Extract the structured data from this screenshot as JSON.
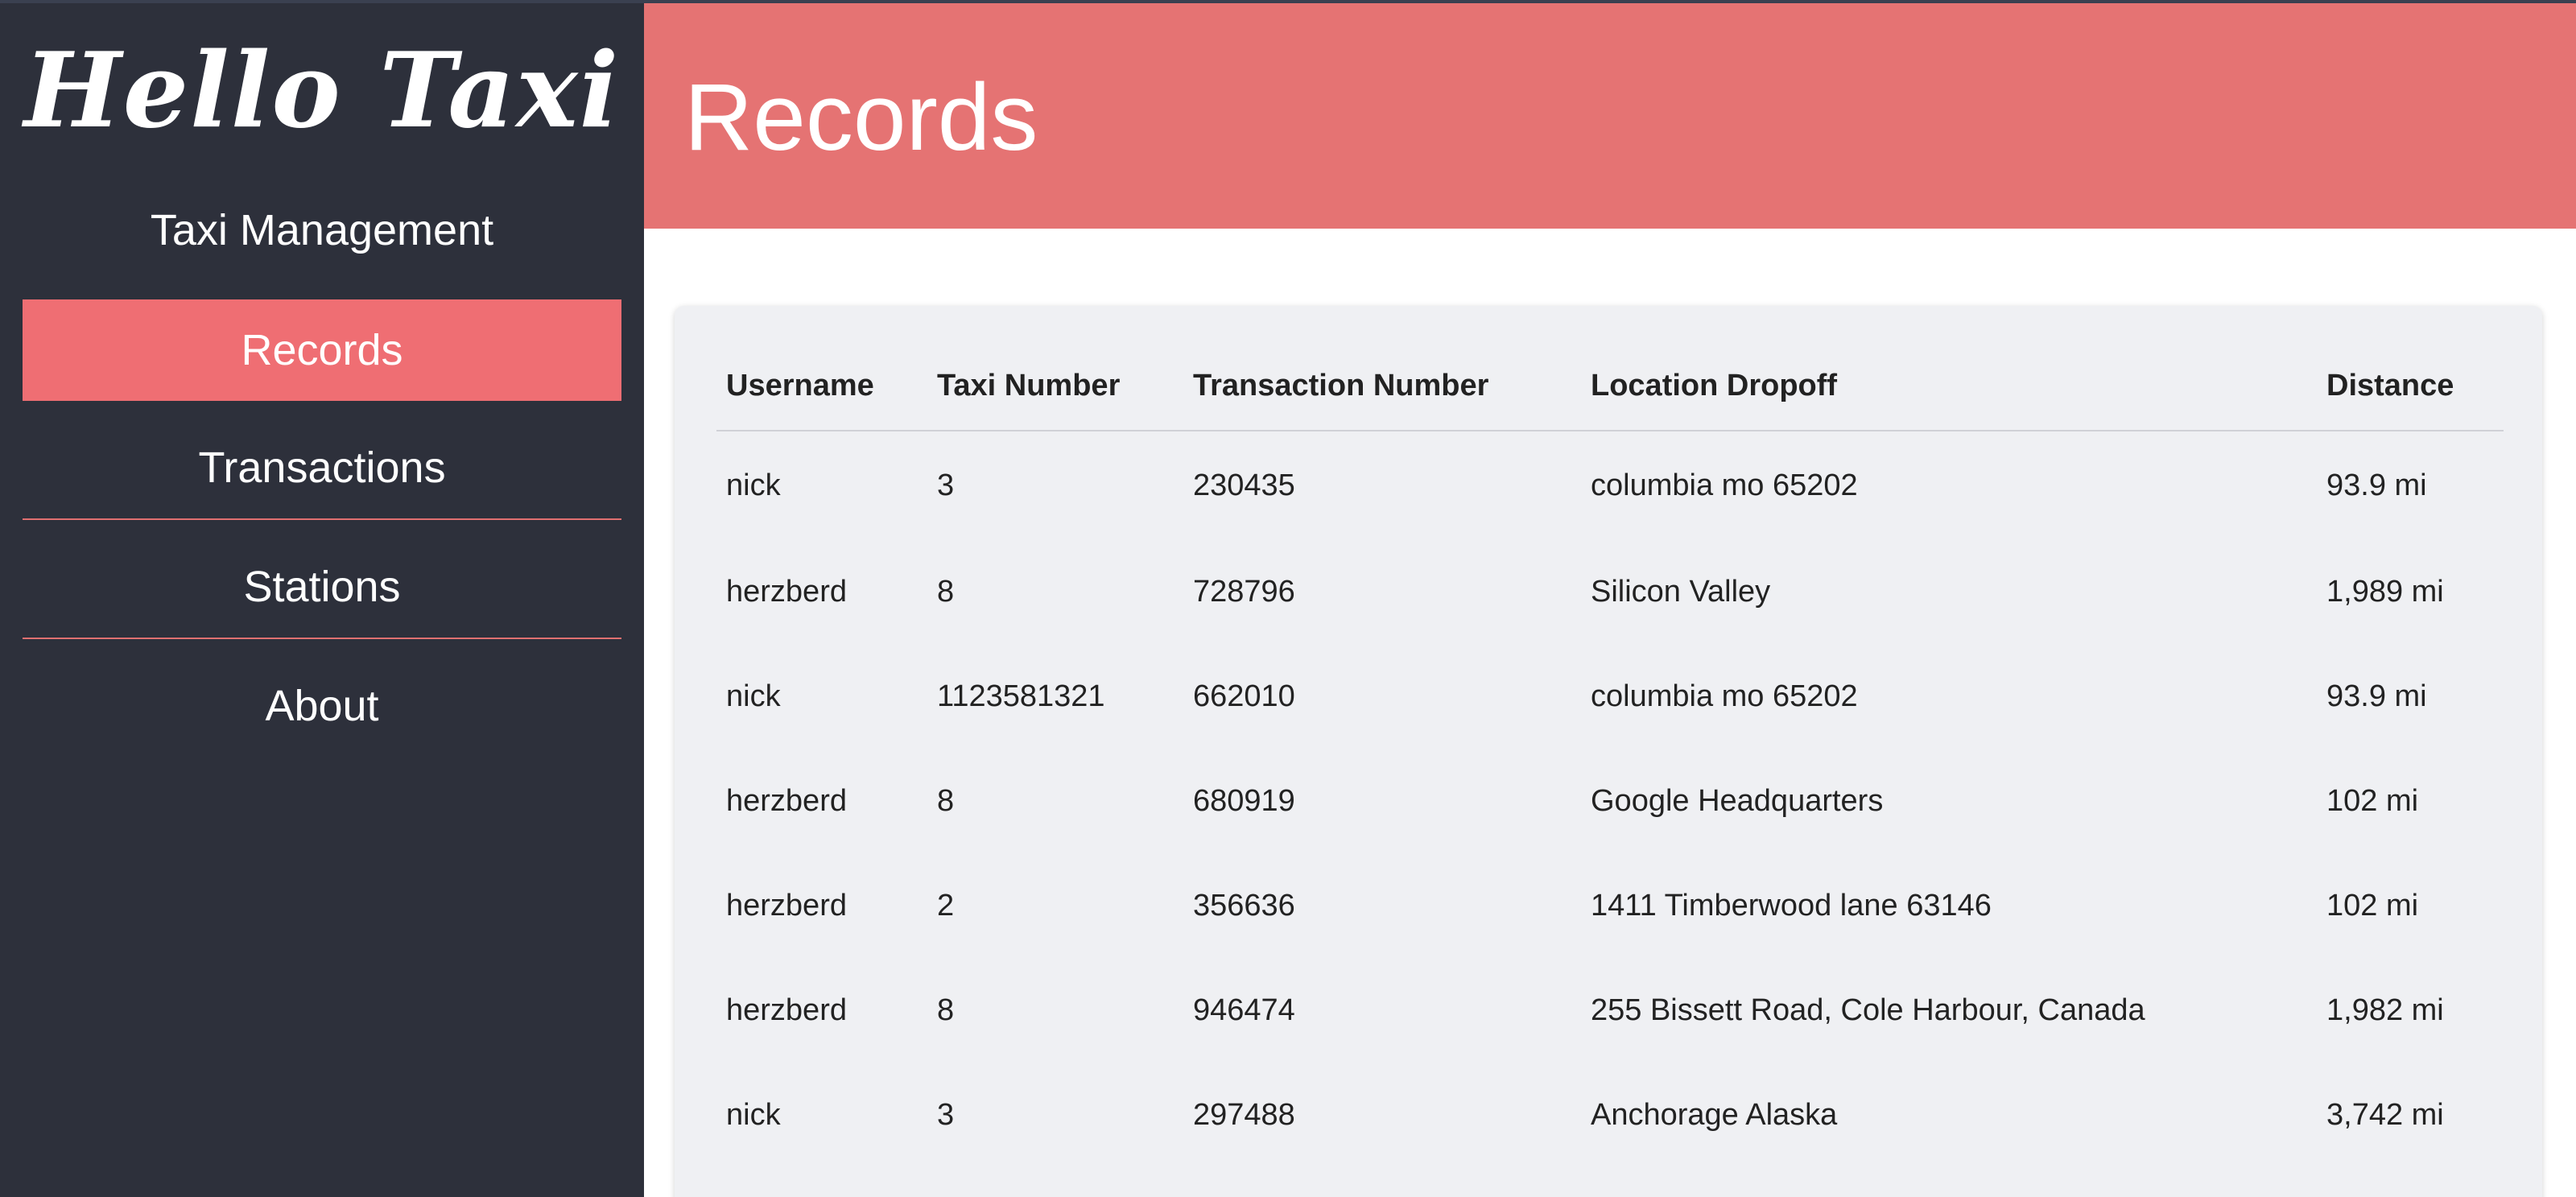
{
  "sidebar": {
    "brand": "Hello Taxi",
    "subtitle": "Taxi Management",
    "nav": [
      {
        "label": "Records",
        "active": true
      },
      {
        "label": "Transactions",
        "active": false
      },
      {
        "label": "Stations",
        "active": false
      },
      {
        "label": "About",
        "active": false
      }
    ]
  },
  "header": {
    "title": "Records"
  },
  "table": {
    "columns": [
      "Username",
      "Taxi Number",
      "Transaction Number",
      "Location Dropoff",
      "Distance"
    ],
    "rows": [
      [
        "nick",
        "3",
        "230435",
        "columbia mo 65202",
        "93.9 mi"
      ],
      [
        "herzberd",
        "8",
        "728796",
        "Silicon Valley",
        "1,989 mi"
      ],
      [
        "nick",
        "1123581321",
        "662010",
        "columbia mo 65202",
        "93.9 mi"
      ],
      [
        "herzberd",
        "8",
        "680919",
        "Google Headquarters",
        "102 mi"
      ],
      [
        "herzberd",
        "2",
        "356636",
        "1411 Timberwood lane 63146",
        "102 mi"
      ],
      [
        "herzberd",
        "8",
        "946474",
        "255 Bissett Road, Cole Harbour, Canada",
        "1,982 mi"
      ],
      [
        "nick",
        "3",
        "297488",
        "Anchorage Alaska",
        "3,742 mi"
      ]
    ]
  },
  "colors": {
    "sidebar_bg": "#2d303b",
    "accent": "#ef6e73",
    "header_bg": "#e57373",
    "card_bg": "#eff0f3"
  }
}
